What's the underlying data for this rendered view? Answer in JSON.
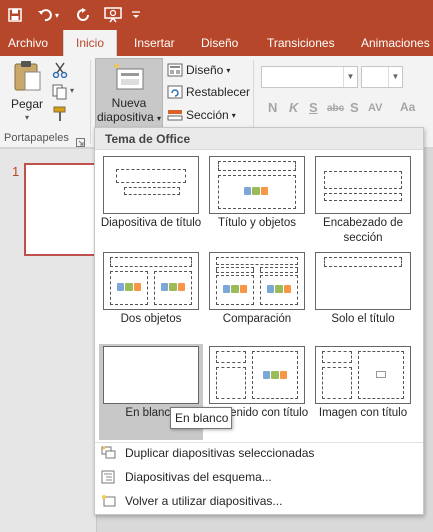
{
  "colors": {
    "accent": "#b7472a",
    "ribbon_bg": "#f3f3f3",
    "selected_thumb_border": "#c0504d"
  },
  "qat": {
    "save_icon": "save-icon",
    "undo_icon": "undo-icon",
    "redo_icon": "repeat-icon",
    "present_icon": "present-from-start-icon",
    "customize_icon": "customize-qat-icon"
  },
  "tabs": [
    {
      "label": "Archivo"
    },
    {
      "label": "Inicio"
    },
    {
      "label": "Insertar"
    },
    {
      "label": "Diseño"
    },
    {
      "label": "Transiciones"
    },
    {
      "label": "Animaciones"
    }
  ],
  "ribbon": {
    "pegar_label": "Pegar",
    "nueva_line1": "Nueva",
    "nueva_line2": "diapositiva",
    "diseno_label": "Diseño",
    "restablecer_label": "Restablecer",
    "seccion_label": "Sección",
    "portapapeles_label": "Portapapeles",
    "font_letters": [
      "N",
      "K",
      "S",
      "abc",
      "S",
      "AV",
      "Aa"
    ]
  },
  "slides_pane": {
    "slide_number": "1"
  },
  "gallery": {
    "header": "Tema de Office",
    "layouts": [
      {
        "caption": "Diapositiva de título"
      },
      {
        "caption": "Título y objetos"
      },
      {
        "caption": "Encabezado de sección"
      },
      {
        "caption": "Dos objetos"
      },
      {
        "caption": "Comparación"
      },
      {
        "caption": "Solo el título"
      },
      {
        "caption": "En blanco"
      },
      {
        "caption": "Contenido con título"
      },
      {
        "caption": "Imagen con título"
      }
    ],
    "menu": [
      {
        "label": "Duplicar diapositivas seleccionadas"
      },
      {
        "label": "Diapositivas del esquema..."
      },
      {
        "label": "Volver a utilizar diapositivas..."
      }
    ]
  },
  "tooltip": "En blanco"
}
